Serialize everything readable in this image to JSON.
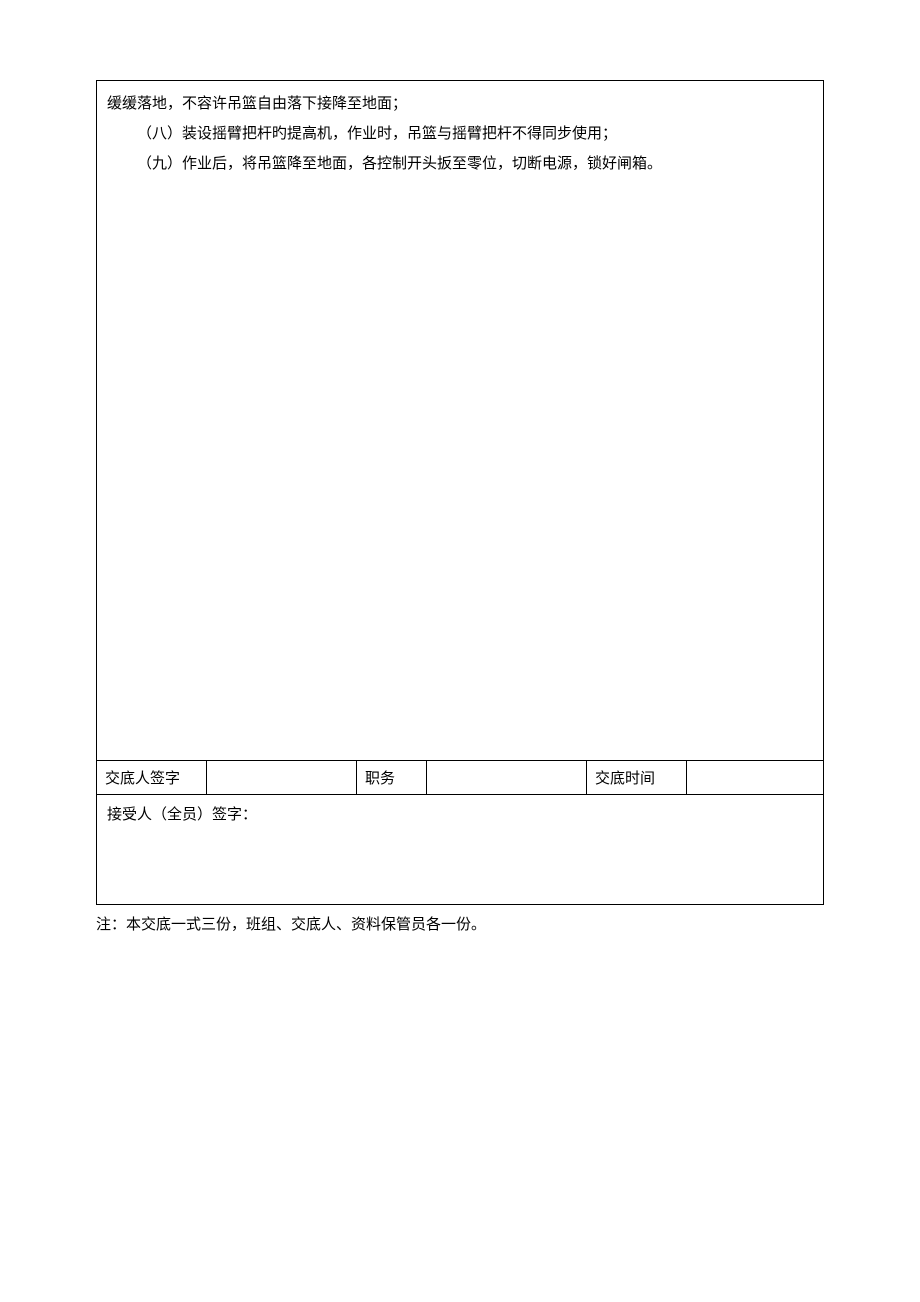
{
  "content": {
    "line1": "缓缓落地，不容许吊篮自由落下接降至地面；",
    "line2": "（八）装设摇臂把杆旳提高机，作业时，吊篮与摇臂把杆不得同步使用；",
    "line3": "（九）作业后，将吊篮降至地面，各控制开头扳至零位，切断电源，锁好闸箱。"
  },
  "signature": {
    "presenter_label": "交底人签字",
    "presenter_value": "",
    "position_label": "职务",
    "position_value": "",
    "time_label": "交底时间",
    "time_value": ""
  },
  "recipient": {
    "label": "接受人（全员）签字："
  },
  "footnote": "注：本交底一式三份，班组、交底人、资料保管员各一份。"
}
